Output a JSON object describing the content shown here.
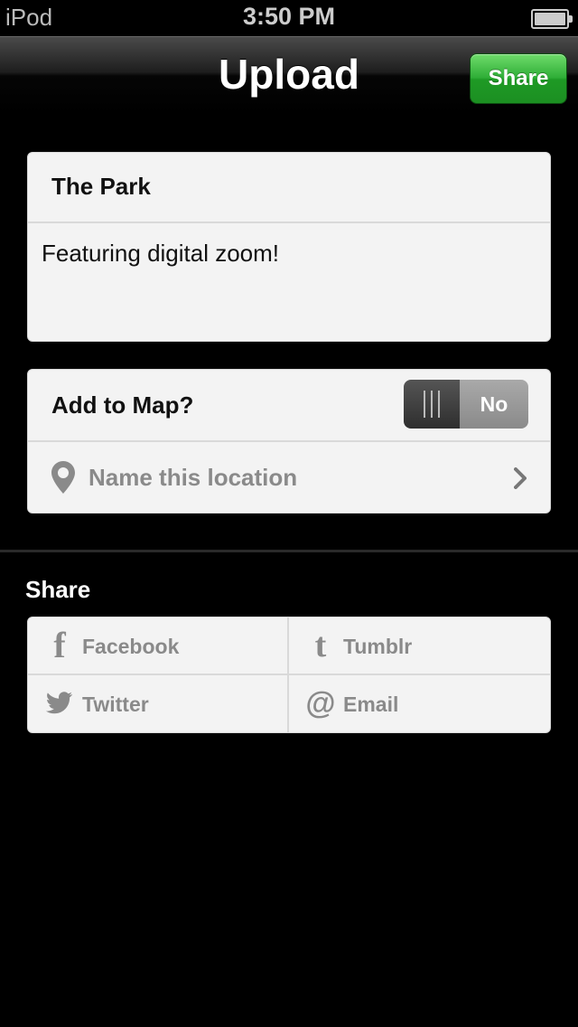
{
  "status_bar": {
    "carrier": "iPod",
    "time": "3:50 PM",
    "battery_icon": "battery-full-icon"
  },
  "nav": {
    "title": "Upload",
    "share_button_label": "Share",
    "share_button_color": "#2fae37"
  },
  "post": {
    "title": "The Park",
    "description": "Featuring digital zoom!"
  },
  "map": {
    "label": "Add to Map?",
    "toggle_value": "No",
    "location_placeholder": "Name this location",
    "location_icon": "map-pin-icon",
    "chevron_icon": "chevron-right-icon"
  },
  "share": {
    "header": "Share",
    "services": [
      {
        "label": "Facebook",
        "icon": "facebook-icon"
      },
      {
        "label": "Tumblr",
        "icon": "tumblr-icon"
      },
      {
        "label": "Twitter",
        "icon": "twitter-icon"
      },
      {
        "label": "Email",
        "icon": "email-icon"
      }
    ]
  }
}
